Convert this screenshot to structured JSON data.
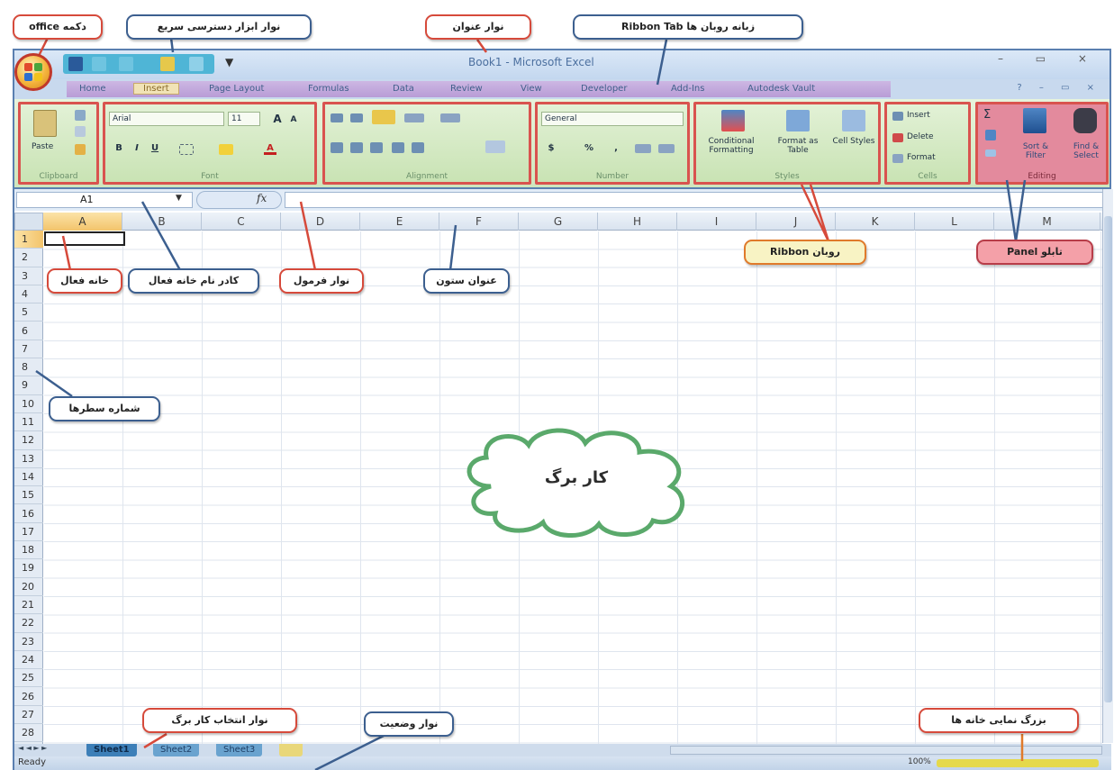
{
  "window": {
    "title": "Book1 - Microsoft Excel",
    "controls": "– ▭ ×",
    "help_controls": "? – ▭ ×",
    "qat_more": "▼"
  },
  "tabs": [
    "Home",
    "Insert",
    "Page Layout",
    "Formulas",
    "Data",
    "Review",
    "View",
    "Developer",
    "Add-Ins",
    "Autodesk Vault"
  ],
  "ribbon": {
    "clipboard": {
      "paste": "Paste",
      "label": "Clipboard"
    },
    "font": {
      "name": "Arial",
      "size": "11",
      "grow": "A",
      "shrink": "A",
      "bold": "B",
      "italic": "I",
      "underline": "U",
      "color": "A",
      "label": "Font"
    },
    "alignment": {
      "label": "Alignment"
    },
    "number": {
      "format": "General",
      "currency": "$",
      "percent": "%",
      "comma": ",",
      "label": "Number"
    },
    "styles": {
      "conditional": "Conditional Formatting",
      "format_table": "Format as Table",
      "cell_styles": "Cell Styles",
      "label": "Styles"
    },
    "cells": {
      "insert": "Insert",
      "delete": "Delete",
      "format": "Format",
      "label": "Cells"
    },
    "editing": {
      "sum": "Σ",
      "sort": "Sort & Filter",
      "find": "Find & Select",
      "label": "Editing"
    }
  },
  "formula_bar": {
    "name_box": "A1",
    "fx": "fx"
  },
  "columns": [
    "A",
    "B",
    "C",
    "D",
    "E",
    "F",
    "G",
    "H",
    "I",
    "J",
    "K",
    "L",
    "M"
  ],
  "rows": [
    "1",
    "2",
    "3",
    "4",
    "5",
    "6",
    "7",
    "8",
    "9",
    "10",
    "11",
    "12",
    "13",
    "14",
    "15",
    "16",
    "17",
    "18",
    "19",
    "20",
    "21",
    "22",
    "23",
    "24",
    "25",
    "26",
    "27",
    "28"
  ],
  "sheets": [
    "Sheet1",
    "Sheet2",
    "Sheet3"
  ],
  "sheet_nav": "◄ ◄ ► ►",
  "status": {
    "text": "Ready",
    "zoom": "100%"
  },
  "callouts": {
    "office": "دکمه office",
    "quick_access": "نوار ابزار دسترسی سریع",
    "title_bar": "نوار عنوان",
    "ribbon_tab": "زبانه روبان ها Ribbon Tab",
    "active_cell": "خانه فعال",
    "name_box": "کادر نام خانه فعال",
    "formula_bar": "نوار فرمول",
    "column_header": "عنوان ستون",
    "ribbon": "روبان Ribbon",
    "panel": "تابلو Panel",
    "row_numbers": "شماره سطرها",
    "worksheet": "کار برگ",
    "sheet_selector": "نوار انتخاب کار برگ",
    "status_bar": "نوار وضعیت",
    "zoom": "بزرگ نمایی خانه ها"
  }
}
